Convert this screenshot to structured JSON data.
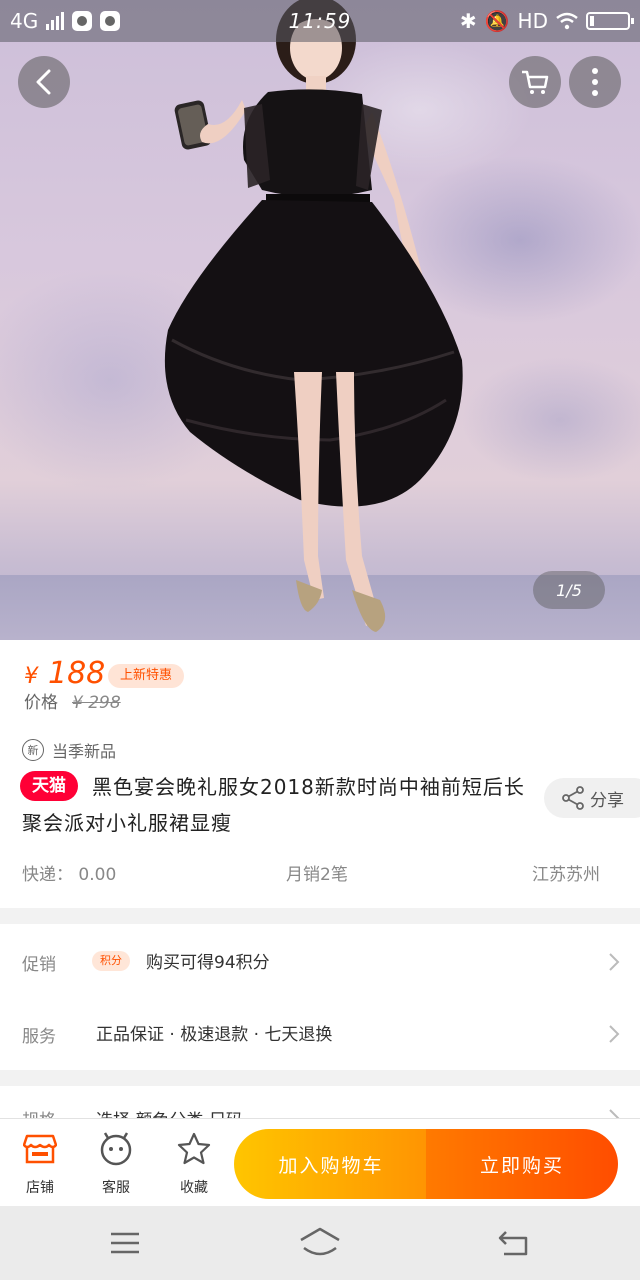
{
  "status_bar": {
    "network": "4G",
    "time": "11:59",
    "hd": "HD"
  },
  "gallery": {
    "counter": "1/5"
  },
  "price": {
    "currency": "¥",
    "value": "188",
    "promo_tag": "上新特惠",
    "original_label": "价格",
    "original_value": "¥ 298"
  },
  "product": {
    "new_badge_char": "新",
    "new_label": "当季新品",
    "store_badge": "天猫",
    "title": "黑色宴会晚礼服女2018新款时尚中袖前短后长聚会派对小礼服裙显瘦",
    "share_label": "分享",
    "shipping": "快递： 0.00",
    "monthly_sales": "月销2笔",
    "location": "江苏苏州"
  },
  "rows": {
    "promotion": {
      "label": "促销",
      "pill": "积分",
      "text": "购买可得94积分"
    },
    "service": {
      "label": "服务",
      "text": "正品保证 · 极速退款 · 七天退换"
    },
    "partial": {
      "label": "规格",
      "text": "选择 颜色分类 尺码"
    }
  },
  "action_bar": {
    "store_label": "店铺",
    "service_label": "客服",
    "favorite_label": "收藏",
    "add_to_cart": "加入购物车",
    "buy_now": "立即购买"
  },
  "colors": {
    "accent": "#ff5000",
    "tmall": "#ff0036",
    "cart_gradient": [
      "#ffc500",
      "#ff9402"
    ],
    "buy_gradient": [
      "#ff7a00",
      "#ff4d00"
    ]
  }
}
